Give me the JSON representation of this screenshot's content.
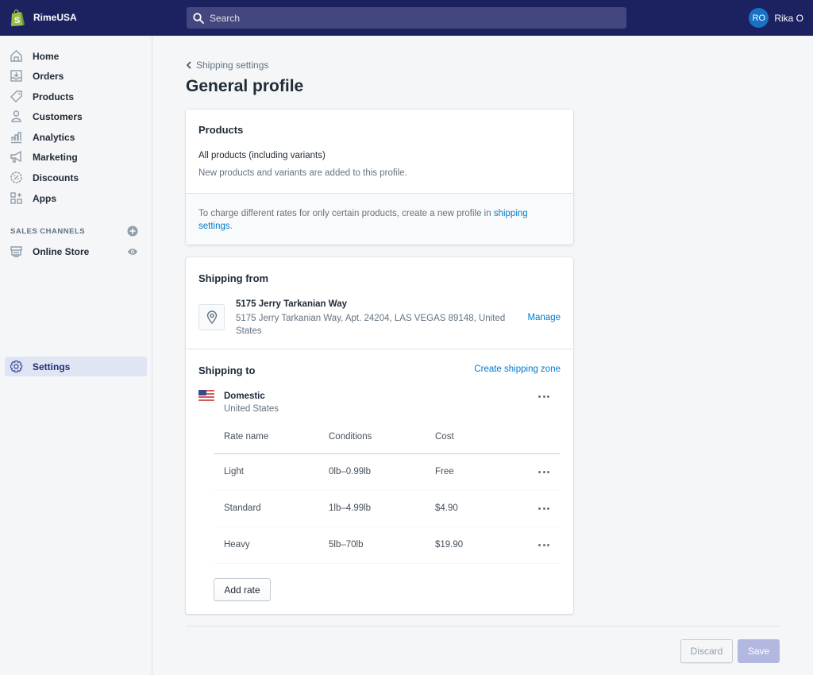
{
  "topbar": {
    "store_name": "RimeUSA",
    "search_placeholder": "Search",
    "user_initials": "RO",
    "user_name": "Rika O",
    "brand_color": "#1c2260",
    "avatar_color": "#1672c5"
  },
  "sidebar": {
    "items": [
      {
        "label": "Home",
        "icon": "home-icon"
      },
      {
        "label": "Orders",
        "icon": "orders-icon"
      },
      {
        "label": "Products",
        "icon": "tag-icon"
      },
      {
        "label": "Customers",
        "icon": "person-icon"
      },
      {
        "label": "Analytics",
        "icon": "bar-chart-icon"
      },
      {
        "label": "Marketing",
        "icon": "megaphone-icon"
      },
      {
        "label": "Discounts",
        "icon": "discount-icon"
      },
      {
        "label": "Apps",
        "icon": "apps-icon"
      }
    ],
    "sales_channels_label": "SALES CHANNELS",
    "online_store_label": "Online Store",
    "settings_label": "Settings"
  },
  "page": {
    "breadcrumb": "Shipping settings",
    "title": "General profile"
  },
  "products_card": {
    "title": "Products",
    "scope": "All products (including variants)",
    "note": "New products and variants are added to this profile.",
    "footer_text": "To charge different rates for only certain products, create a new profile in ",
    "footer_link": "shipping settings",
    "footer_end": "."
  },
  "shipping_from": {
    "title": "Shipping from",
    "location_name": "5175 Jerry Tarkanian Way",
    "address_line1": "5175 Jerry Tarkanian Way, Apt. 24204, LAS VEGAS 89148, United",
    "address_line2": "States",
    "manage_label": "Manage"
  },
  "shipping_to": {
    "title": "Shipping to",
    "create_zone_label": "Create shipping zone",
    "zone_name": "Domestic",
    "zone_country": "United States",
    "columns": [
      "Rate name",
      "Conditions",
      "Cost"
    ],
    "rates": [
      {
        "name": "Light",
        "conditions": "0lb–0.99lb",
        "cost": "Free"
      },
      {
        "name": "Standard",
        "conditions": "1lb–4.99lb",
        "cost": "$4.90"
      },
      {
        "name": "Heavy",
        "conditions": "5lb–70lb",
        "cost": "$19.90"
      }
    ],
    "add_rate_label": "Add rate"
  },
  "footer": {
    "discard_label": "Discard",
    "save_label": "Save"
  }
}
